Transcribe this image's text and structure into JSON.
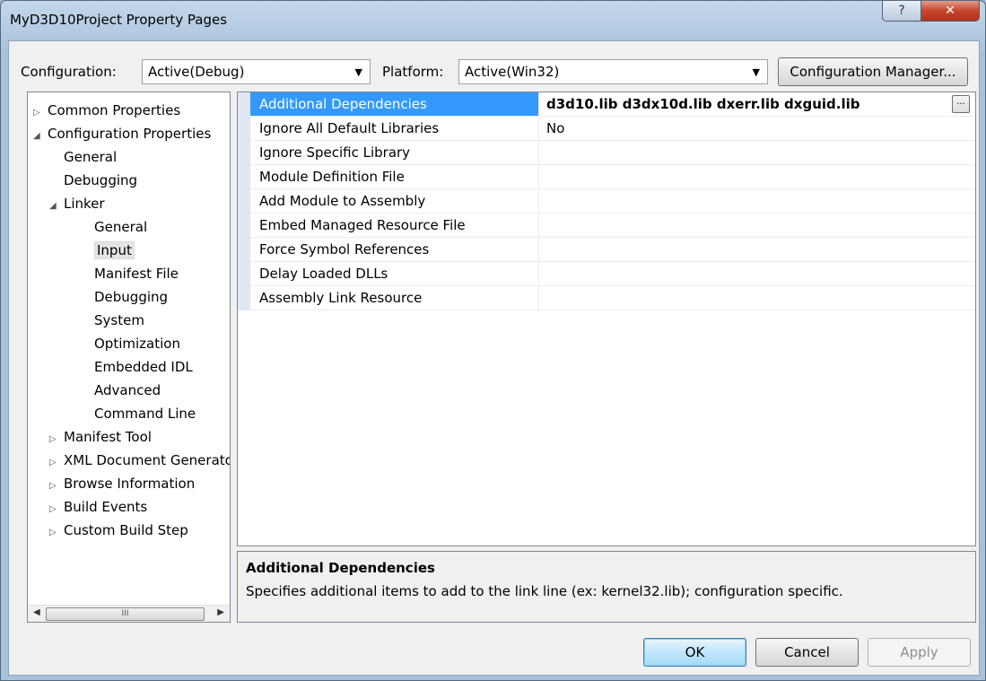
{
  "window": {
    "title": "MyD3D10Project Property Pages",
    "help_glyph": "?",
    "close_glyph": "✕"
  },
  "top": {
    "configuration_label": "Configuration:",
    "configuration_value": "Active(Debug)",
    "platform_label": "Platform:",
    "platform_value": "Active(Win32)",
    "config_manager_label": "Configuration Manager...",
    "dropdown_glyph": "▼"
  },
  "tree": {
    "items": [
      {
        "label": "Common Properties",
        "expander": "▷",
        "level": 0
      },
      {
        "label": "Configuration Properties",
        "expander": "◢",
        "level": 0
      },
      {
        "label": "General",
        "expander": "",
        "level": 1
      },
      {
        "label": "Debugging",
        "expander": "",
        "level": 1
      },
      {
        "label": "Linker",
        "expander": "◢",
        "level": 1
      },
      {
        "label": "General",
        "expander": "",
        "level": 2
      },
      {
        "label": "Input",
        "expander": "",
        "level": 2,
        "selected": true
      },
      {
        "label": "Manifest File",
        "expander": "",
        "level": 2
      },
      {
        "label": "Debugging",
        "expander": "",
        "level": 2
      },
      {
        "label": "System",
        "expander": "",
        "level": 2
      },
      {
        "label": "Optimization",
        "expander": "",
        "level": 2
      },
      {
        "label": "Embedded IDL",
        "expander": "",
        "level": 2
      },
      {
        "label": "Advanced",
        "expander": "",
        "level": 2
      },
      {
        "label": "Command Line",
        "expander": "",
        "level": 2
      },
      {
        "label": "Manifest Tool",
        "expander": "▷",
        "level": 1
      },
      {
        "label": "XML Document Generator",
        "expander": "▷",
        "level": 1
      },
      {
        "label": "Browse Information",
        "expander": "▷",
        "level": 1
      },
      {
        "label": "Build Events",
        "expander": "▷",
        "level": 1
      },
      {
        "label": "Custom Build Step",
        "expander": "▷",
        "level": 1
      }
    ],
    "scroll_left": "◀",
    "scroll_right": "▶",
    "thumb_grip": "III"
  },
  "grid": {
    "rows": [
      {
        "name": "Additional Dependencies",
        "value": "d3d10.lib d3dx10d.lib dxerr.lib dxguid.lib",
        "selected": true
      },
      {
        "name": "Ignore All Default Libraries",
        "value": "No"
      },
      {
        "name": "Ignore Specific Library",
        "value": ""
      },
      {
        "name": "Module Definition File",
        "value": ""
      },
      {
        "name": "Add Module to Assembly",
        "value": ""
      },
      {
        "name": "Embed Managed Resource File",
        "value": ""
      },
      {
        "name": "Force Symbol References",
        "value": ""
      },
      {
        "name": "Delay Loaded DLLs",
        "value": ""
      },
      {
        "name": "Assembly Link Resource",
        "value": ""
      }
    ],
    "ellipsis": "..."
  },
  "description": {
    "title": "Additional Dependencies",
    "text": "Specifies additional items to add to the link line (ex: kernel32.lib); configuration specific."
  },
  "buttons": {
    "ok": "OK",
    "cancel": "Cancel",
    "apply": "Apply"
  }
}
